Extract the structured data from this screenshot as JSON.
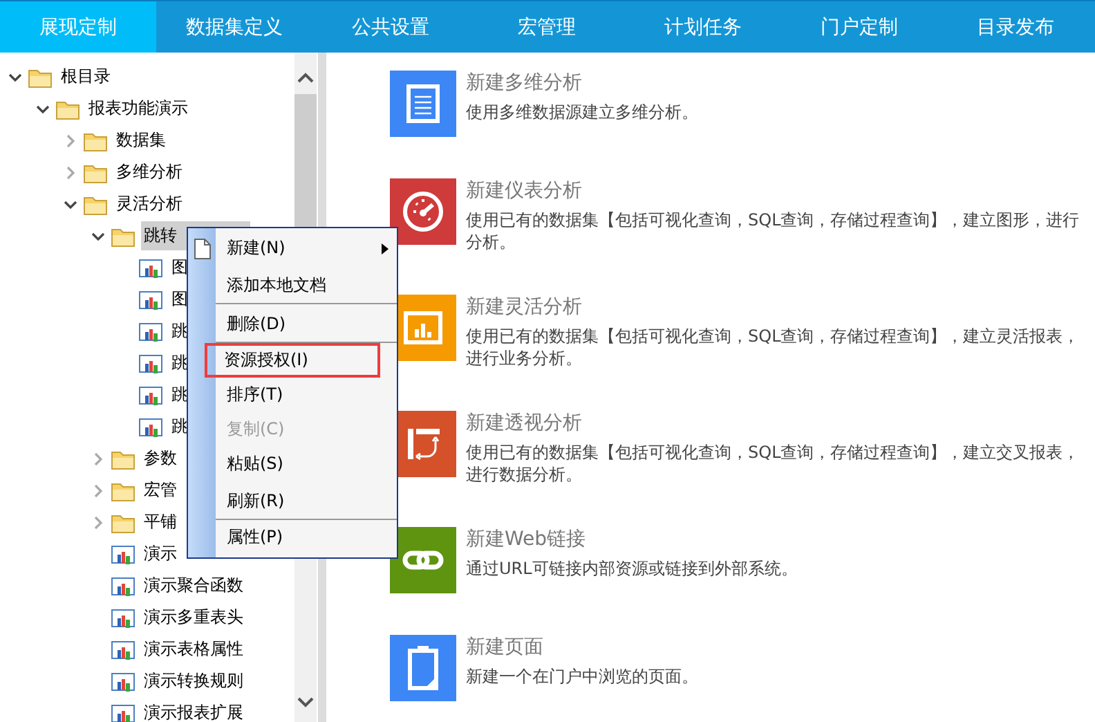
{
  "nav_tabs": [
    {
      "label": "展现定制",
      "selected": true
    },
    {
      "label": "数据集定义",
      "selected": false
    },
    {
      "label": "公共设置",
      "selected": false
    },
    {
      "label": "宏管理",
      "selected": false
    },
    {
      "label": "计划任务",
      "selected": false
    },
    {
      "label": "门户定制",
      "selected": false
    },
    {
      "label": "目录发布",
      "selected": false
    }
  ],
  "tree": [
    {
      "label": "根目录",
      "kind": "folder",
      "expanded": true,
      "selected": false,
      "children": [
        {
          "label": "报表功能演示",
          "kind": "folder",
          "expanded": true,
          "selected": false,
          "children": [
            {
              "label": "数据集",
              "kind": "folder",
              "expanded": false,
              "selected": false
            },
            {
              "label": "多维分析",
              "kind": "folder",
              "expanded": false,
              "selected": false
            },
            {
              "label": "灵活分析",
              "kind": "folder",
              "expanded": true,
              "selected": false,
              "children": [
                {
                  "label": "跳转",
                  "kind": "folder",
                  "expanded": true,
                  "selected": true,
                  "children": [
                    {
                      "label": "图",
                      "kind": "report",
                      "selected": false
                    },
                    {
                      "label": "图",
                      "kind": "report",
                      "selected": false
                    },
                    {
                      "label": "跳",
                      "kind": "report",
                      "selected": false
                    },
                    {
                      "label": "跳",
                      "kind": "report",
                      "selected": false
                    },
                    {
                      "label": "跳",
                      "kind": "report",
                      "selected": false
                    },
                    {
                      "label": "跳",
                      "kind": "report",
                      "selected": false
                    }
                  ]
                },
                {
                  "label": "参数",
                  "kind": "folder",
                  "expanded": false,
                  "selected": false
                },
                {
                  "label": "宏管",
                  "kind": "folder",
                  "expanded": false,
                  "selected": false
                },
                {
                  "label": "平铺",
                  "kind": "folder",
                  "expanded": false,
                  "selected": false
                },
                {
                  "label": "演示",
                  "kind": "report",
                  "selected": false
                },
                {
                  "label": "演示聚合函数",
                  "kind": "report",
                  "selected": false
                },
                {
                  "label": "演示多重表头",
                  "kind": "report",
                  "selected": false
                },
                {
                  "label": "演示表格属性",
                  "kind": "report",
                  "selected": false
                },
                {
                  "label": "演示转换规则",
                  "kind": "report",
                  "selected": false
                },
                {
                  "label": "演示报表扩展",
                  "kind": "report",
                  "selected": false
                }
              ]
            }
          ]
        }
      ]
    }
  ],
  "context_menu": [
    {
      "label": "新建(N)",
      "icon": true,
      "submenu": true,
      "disabled": false,
      "highlighted": false,
      "separator_after": false
    },
    {
      "label": "添加本地文档",
      "icon": false,
      "submenu": false,
      "disabled": false,
      "highlighted": false,
      "separator_after": true
    },
    {
      "label": "删除(D)",
      "icon": false,
      "submenu": false,
      "disabled": false,
      "highlighted": false,
      "separator_after": true
    },
    {
      "label": "资源授权(I)",
      "icon": false,
      "submenu": false,
      "disabled": false,
      "highlighted": true,
      "separator_after": false
    },
    {
      "label": "排序(T)",
      "icon": false,
      "submenu": false,
      "disabled": false,
      "highlighted": false,
      "separator_after": false
    },
    {
      "label": "复制(C)",
      "icon": false,
      "submenu": false,
      "disabled": true,
      "highlighted": false,
      "separator_after": false
    },
    {
      "label": "粘贴(S)",
      "icon": false,
      "submenu": false,
      "disabled": false,
      "highlighted": false,
      "separator_after": false
    },
    {
      "label": "刷新(R)",
      "icon": false,
      "submenu": false,
      "disabled": false,
      "highlighted": false,
      "separator_after": true
    },
    {
      "label": "属性(P)",
      "icon": false,
      "submenu": false,
      "disabled": false,
      "highlighted": false,
      "separator_after": false
    }
  ],
  "actions": [
    {
      "kind": "document",
      "title": "新建多维分析",
      "description": "使用多维数据源建立多维分析。"
    },
    {
      "kind": "gauge",
      "title": "新建仪表分析",
      "description": "使用已有的数据集【包括可视化查询，SQL查询，存储过程查询】，建立图形，进行分析。"
    },
    {
      "kind": "chart",
      "title": "新建灵活分析",
      "description": "使用已有的数据集【包括可视化查询，SQL查询，存储过程查询】，建立灵活报表，进行业务分析。"
    },
    {
      "kind": "pivot",
      "title": "新建透视分析",
      "description": "使用已有的数据集【包括可视化查询，SQL查询，存储过程查询】，建立交叉报表，进行数据分析。"
    },
    {
      "kind": "link",
      "title": "新建Web链接",
      "description": "通过URL可链接内部资源或链接到外部系统。"
    },
    {
      "kind": "page",
      "title": "新建页面",
      "description": "新建一个在门户中浏览的页面。"
    }
  ]
}
